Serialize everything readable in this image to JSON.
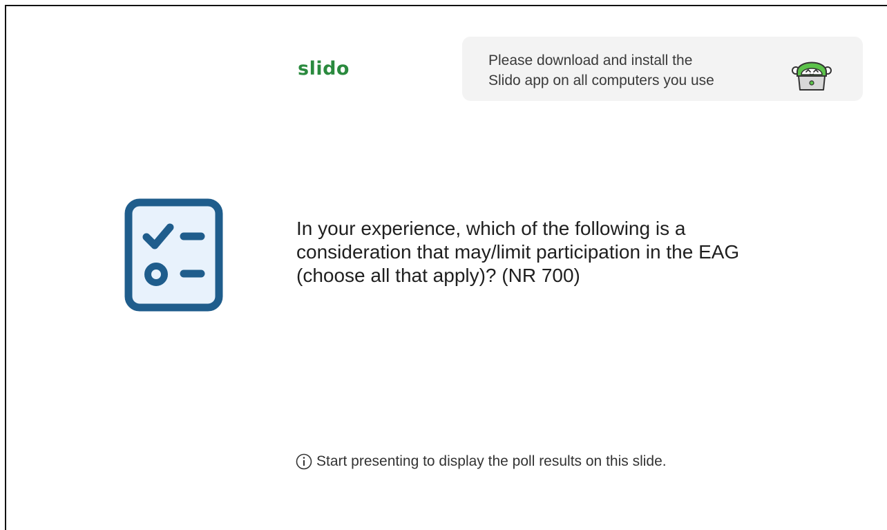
{
  "logo": {
    "text": "slido",
    "color": "#2a8a3e"
  },
  "banner": {
    "lines": [
      "Please download and install the",
      "Slido app on all computers you use"
    ],
    "mascot_icon": "slido-mascot-laptop-icon"
  },
  "poll": {
    "icon": "checklist-icon",
    "question_lines": [
      "In your experience, which of the following is a",
      "consideration that may/limit participation in the EAG",
      "(choose all that apply)? (NR 700)"
    ]
  },
  "footer": {
    "icon": "info-icon",
    "text": "Start presenting to display the poll results on this slide."
  },
  "colors": {
    "accent_green": "#2a8a3e",
    "icon_blue": "#1f5d8c",
    "icon_fill": "#e6f1fb",
    "banner_bg": "#f3f3f3"
  }
}
